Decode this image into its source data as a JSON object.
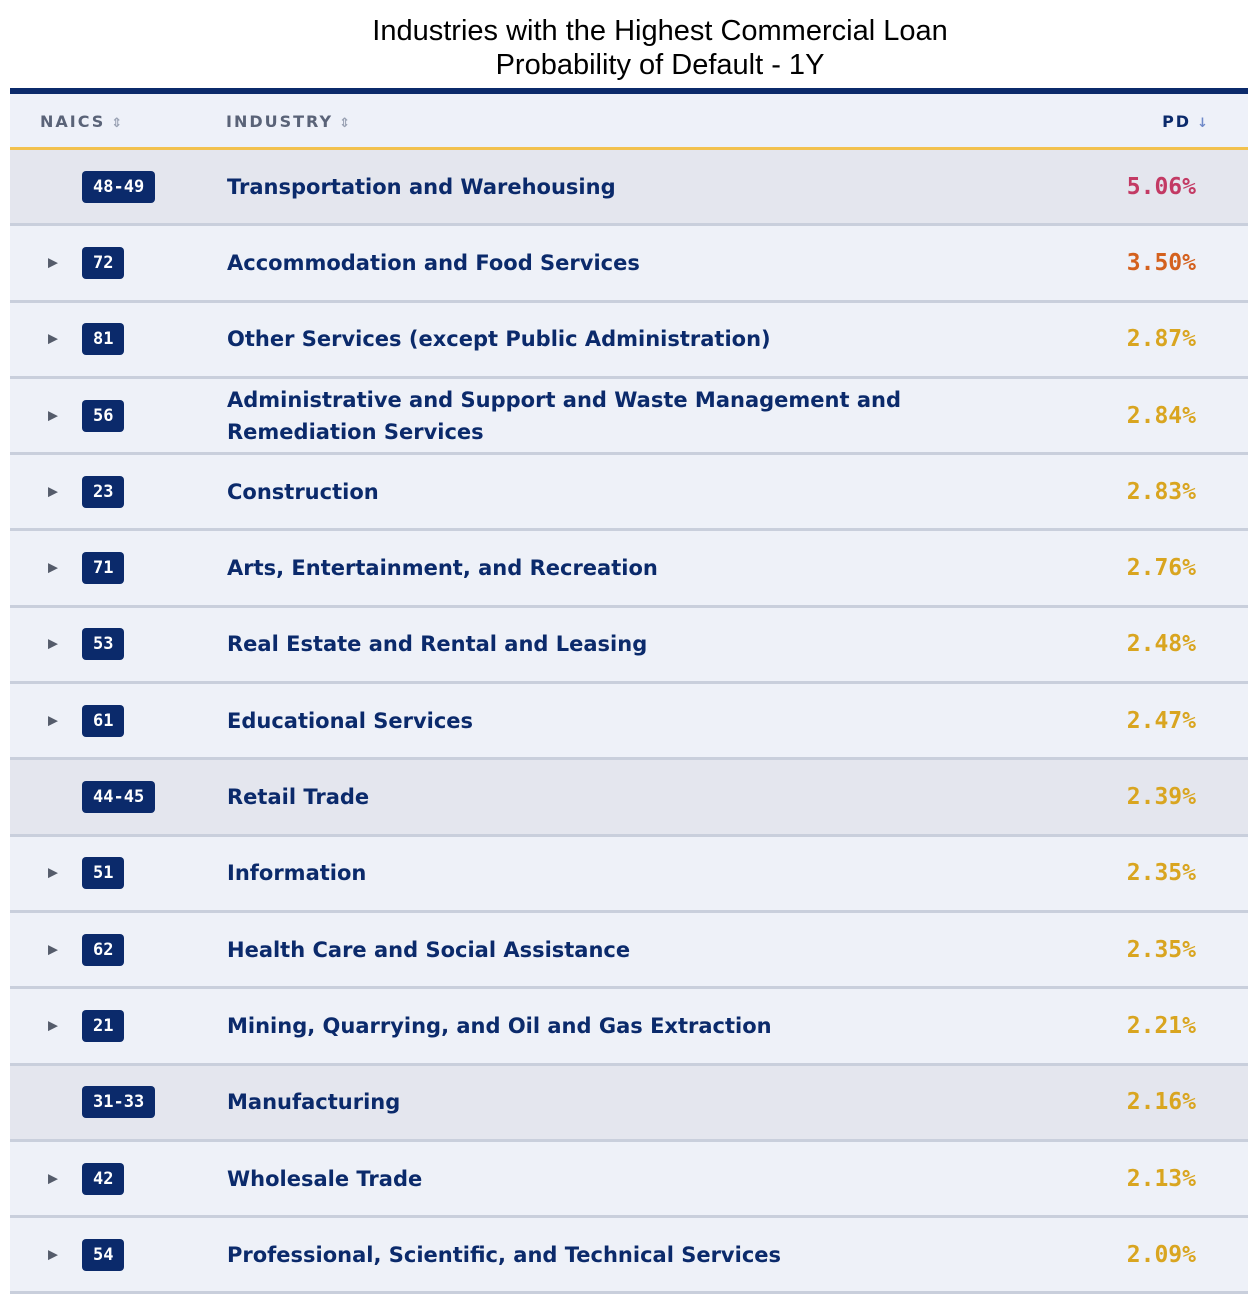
{
  "title_line1": "Industries with the Highest Commercial Loan",
  "title_line2": "Probability of Default - 1Y",
  "columns": {
    "naics": "NAICS",
    "industry": "INDUSTRY",
    "pd": "PD"
  },
  "colors": {
    "header_bar": "#0b2a6b",
    "header_underline": "#f2c14e",
    "badge": "#0b2a6b",
    "pd_high": "#c33a64",
    "pd_mid": "#d4611e",
    "pd_low": "#d9a520"
  },
  "chart_data": {
    "type": "table",
    "title": "Industries with the Highest Commercial Loan Probability of Default - 1Y",
    "columns": [
      "NAICS",
      "INDUSTRY",
      "PD"
    ],
    "rows": [
      {
        "naics": "48-49",
        "industry": "Transportation and Warehousing",
        "pd": "5.06%",
        "value": 5.06,
        "expandable": false,
        "color": "#c33a64"
      },
      {
        "naics": "72",
        "industry": "Accommodation and Food Services",
        "pd": "3.50%",
        "value": 3.5,
        "expandable": true,
        "color": "#d4611e"
      },
      {
        "naics": "81",
        "industry": "Other Services (except Public Administration)",
        "pd": "2.87%",
        "value": 2.87,
        "expandable": true,
        "color": "#d9a520"
      },
      {
        "naics": "56",
        "industry": "Administrative and Support and Waste Management and Remediation Services",
        "pd": "2.84%",
        "value": 2.84,
        "expandable": true,
        "color": "#d9a520"
      },
      {
        "naics": "23",
        "industry": "Construction",
        "pd": "2.83%",
        "value": 2.83,
        "expandable": true,
        "color": "#d9a520"
      },
      {
        "naics": "71",
        "industry": "Arts, Entertainment, and Recreation",
        "pd": "2.76%",
        "value": 2.76,
        "expandable": true,
        "color": "#d9a520"
      },
      {
        "naics": "53",
        "industry": "Real Estate and Rental and Leasing",
        "pd": "2.48%",
        "value": 2.48,
        "expandable": true,
        "color": "#d9a520"
      },
      {
        "naics": "61",
        "industry": "Educational Services",
        "pd": "2.47%",
        "value": 2.47,
        "expandable": true,
        "color": "#d9a520"
      },
      {
        "naics": "44-45",
        "industry": "Retail Trade",
        "pd": "2.39%",
        "value": 2.39,
        "expandable": false,
        "color": "#d9a520"
      },
      {
        "naics": "51",
        "industry": "Information",
        "pd": "2.35%",
        "value": 2.35,
        "expandable": true,
        "color": "#d9a520"
      },
      {
        "naics": "62",
        "industry": "Health Care and Social Assistance",
        "pd": "2.35%",
        "value": 2.35,
        "expandable": true,
        "color": "#d9a520"
      },
      {
        "naics": "21",
        "industry": "Mining, Quarrying, and Oil and Gas Extraction",
        "pd": "2.21%",
        "value": 2.21,
        "expandable": true,
        "color": "#d9a520"
      },
      {
        "naics": "31-33",
        "industry": "Manufacturing",
        "pd": "2.16%",
        "value": 2.16,
        "expandable": false,
        "color": "#d9a520"
      },
      {
        "naics": "42",
        "industry": "Wholesale Trade",
        "pd": "2.13%",
        "value": 2.13,
        "expandable": true,
        "color": "#d9a520"
      },
      {
        "naics": "54",
        "industry": "Professional, Scientific, and Technical Services",
        "pd": "2.09%",
        "value": 2.09,
        "expandable": true,
        "color": "#d9a520"
      }
    ]
  }
}
